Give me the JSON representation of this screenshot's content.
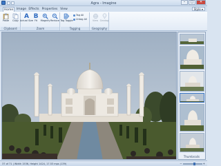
{
  "window": {
    "title": "Agra - Imagine",
    "minimize_label": "–",
    "maximize_label": "□",
    "close_label": "✕"
  },
  "tabs": [
    "Home",
    "Image",
    "Effects",
    "Properties",
    "View"
  ],
  "style_menu": "Style ▾",
  "ribbon": {
    "clipboard": {
      "label": "Clipboard",
      "paste": "Paste",
      "copy": "Copy"
    },
    "zoom": {
      "label": "Zoom",
      "actual_size": "Actual Size",
      "fit": "Fit",
      "magnify": "Magnify",
      "reduce": "Reduce"
    },
    "tagging": {
      "label": "Tagging",
      "tag_toggle": "Tag Toggle",
      "tag_all": "Tag All",
      "untag_all": "Untag All"
    },
    "geography": {
      "label": "Geography",
      "view": "View",
      "geotag": "Geotag"
    }
  },
  "thumbnails": {
    "label": "Thumbnails",
    "count": 6
  },
  "status": {
    "text": "37 of 71  |  Width 1536, Height 1424, 17.53 mps (139)",
    "zoom_value": 0.62
  },
  "colors": {
    "ribbon_bg": "#e2ebf6",
    "accent": "#2d6ac0",
    "sky": "#b4c3d3",
    "marble": "#ece8e1"
  }
}
